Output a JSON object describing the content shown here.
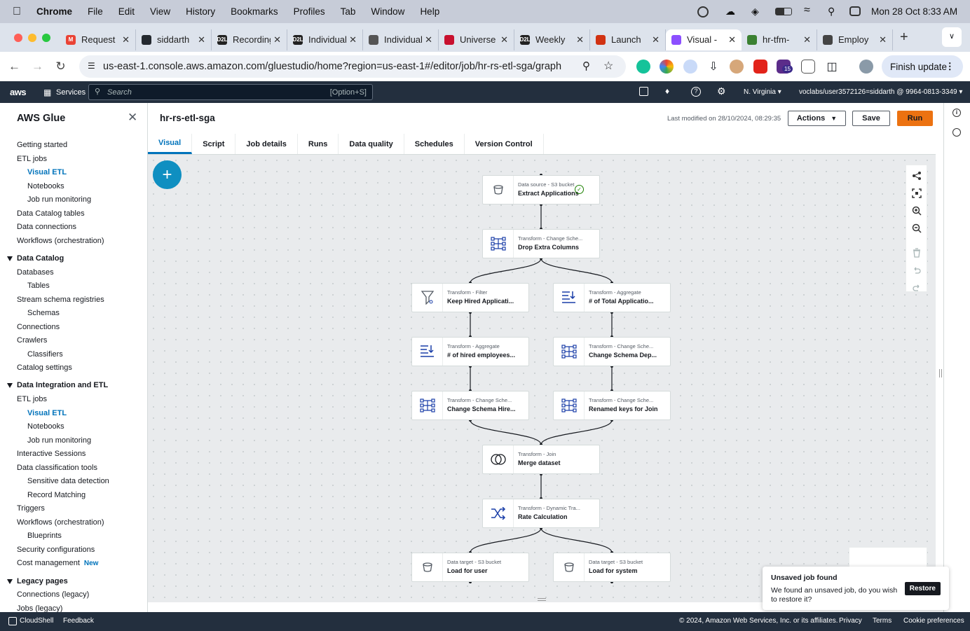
{
  "mac_menu": {
    "app": "Chrome",
    "items": [
      "File",
      "Edit",
      "View",
      "History",
      "Bookmarks",
      "Profiles",
      "Tab",
      "Window",
      "Help"
    ],
    "datetime": "Mon 28 Oct  8:33 AM"
  },
  "tabs": [
    {
      "title": "Request",
      "color": "#ea4335",
      "glyph": "M"
    },
    {
      "title": "siddarth",
      "color": "#24292f",
      "glyph": ""
    },
    {
      "title": "Recording",
      "color": "#222",
      "glyph": "D2L"
    },
    {
      "title": "Individual",
      "color": "#222",
      "glyph": "D2L"
    },
    {
      "title": "Individual",
      "color": "#555",
      "glyph": ""
    },
    {
      "title": "Universe",
      "color": "#c8102e",
      "glyph": ""
    },
    {
      "title": "Weekly",
      "color": "#222",
      "glyph": "D2L"
    },
    {
      "title": "Launch",
      "color": "#d13212",
      "glyph": ""
    },
    {
      "title": "Visual -",
      "color": "#8c4fff",
      "glyph": ""
    },
    {
      "title": "hr-tfm-",
      "color": "#3b8132",
      "glyph": ""
    },
    {
      "title": "Employ",
      "color": "#444",
      "glyph": ""
    }
  ],
  "address": {
    "url": "us-east-1.console.aws.amazon.com/gluestudio/home?region=us-east-1#/editor/job/hr-rs-etl-sga/graph",
    "finish_label": "Finish update",
    "badge": "15"
  },
  "aws_nav": {
    "logo": "aws",
    "services": "Services",
    "search_placeholder": "Search",
    "search_shortcut": "[Option+S]",
    "region": "N. Virginia",
    "account": "voclabs/user3572126=siddarth @ 9964-0813-3349"
  },
  "sidebar": {
    "title": "AWS Glue",
    "items": [
      {
        "label": "Getting started",
        "level": 0
      },
      {
        "label": "ETL jobs",
        "level": 0
      },
      {
        "label": "Visual ETL",
        "level": 1,
        "active": true
      },
      {
        "label": "Notebooks",
        "level": 1
      },
      {
        "label": "Job run monitoring",
        "level": 1
      },
      {
        "label": "Data Catalog tables",
        "level": 0
      },
      {
        "label": "Data connections",
        "level": 0
      },
      {
        "label": "Workflows (orchestration)",
        "level": 0
      },
      {
        "label": "Data Catalog",
        "level": 0,
        "head": true
      },
      {
        "label": "Databases",
        "level": 0
      },
      {
        "label": "Tables",
        "level": 1
      },
      {
        "label": "Stream schema registries",
        "level": 0
      },
      {
        "label": "Schemas",
        "level": 1
      },
      {
        "label": "Connections",
        "level": 0
      },
      {
        "label": "Crawlers",
        "level": 0
      },
      {
        "label": "Classifiers",
        "level": 1
      },
      {
        "label": "Catalog settings",
        "level": 0
      },
      {
        "label": "Data Integration and ETL",
        "level": 0,
        "head": true
      },
      {
        "label": "ETL jobs",
        "level": 0
      },
      {
        "label": "Visual ETL",
        "level": 1,
        "active": true
      },
      {
        "label": "Notebooks",
        "level": 1
      },
      {
        "label": "Job run monitoring",
        "level": 1
      },
      {
        "label": "Interactive Sessions",
        "level": 0
      },
      {
        "label": "Data classification tools",
        "level": 0
      },
      {
        "label": "Sensitive data detection",
        "level": 1
      },
      {
        "label": "Record Matching",
        "level": 1
      },
      {
        "label": "Triggers",
        "level": 0
      },
      {
        "label": "Workflows (orchestration)",
        "level": 0
      },
      {
        "label": "Blueprints",
        "level": 1
      },
      {
        "label": "Security configurations",
        "level": 0
      },
      {
        "label": "Cost management",
        "level": 0,
        "badge": "New"
      },
      {
        "label": "Legacy pages",
        "level": 0,
        "head": true
      },
      {
        "label": "Connections (legacy)",
        "level": 0
      },
      {
        "label": "Jobs (legacy)",
        "level": 0
      }
    ]
  },
  "job": {
    "name": "hr-rs-etl-sga",
    "last_modified": "Last modified on 28/10/2024, 08:29:35",
    "actions_label": "Actions",
    "save_label": "Save",
    "run_label": "Run"
  },
  "job_tabs": [
    "Visual",
    "Script",
    "Job details",
    "Runs",
    "Data quality",
    "Schedules",
    "Version Control"
  ],
  "nodes": [
    {
      "type": "Data source - S3 bucket",
      "name": "Extract Applications",
      "icon": "bucket",
      "status": "ok"
    },
    {
      "type": "Transform - Change Sche...",
      "name": "Drop Extra Columns",
      "icon": "schema"
    },
    {
      "type": "Transform - Filter",
      "name": "Keep Hired Applicati...",
      "icon": "filter"
    },
    {
      "type": "Transform - Aggregate",
      "name": "# of Total Applicatio...",
      "icon": "aggregate"
    },
    {
      "type": "Transform - Aggregate",
      "name": "# of hired employees...",
      "icon": "aggregate"
    },
    {
      "type": "Transform - Change Sche...",
      "name": "Change Schema Dep...",
      "icon": "schema"
    },
    {
      "type": "Transform - Change Sche...",
      "name": "Change Schema Hire...",
      "icon": "schema"
    },
    {
      "type": "Transform - Change Sche...",
      "name": "Renamed keys for Join",
      "icon": "schema"
    },
    {
      "type": "Transform - Join",
      "name": "Merge dataset",
      "icon": "join"
    },
    {
      "type": "Transform - Dynamic Tra...",
      "name": "Rate Calculation",
      "icon": "shuffle"
    },
    {
      "type": "Data target - S3 bucket",
      "name": "Load for user",
      "icon": "bucket"
    },
    {
      "type": "Data target - S3 bucket",
      "name": "Load for system",
      "icon": "bucket"
    }
  ],
  "toast": {
    "title": "Unsaved job found",
    "body": "We found an unsaved job, do you wish to restore it?",
    "button": "Restore"
  },
  "footer": {
    "cloudshell": "CloudShell",
    "feedback": "Feedback",
    "copyright": "© 2024, Amazon Web Services, Inc. or its affiliates.",
    "privacy": "Privacy",
    "terms": "Terms",
    "cookies": "Cookie preferences"
  }
}
